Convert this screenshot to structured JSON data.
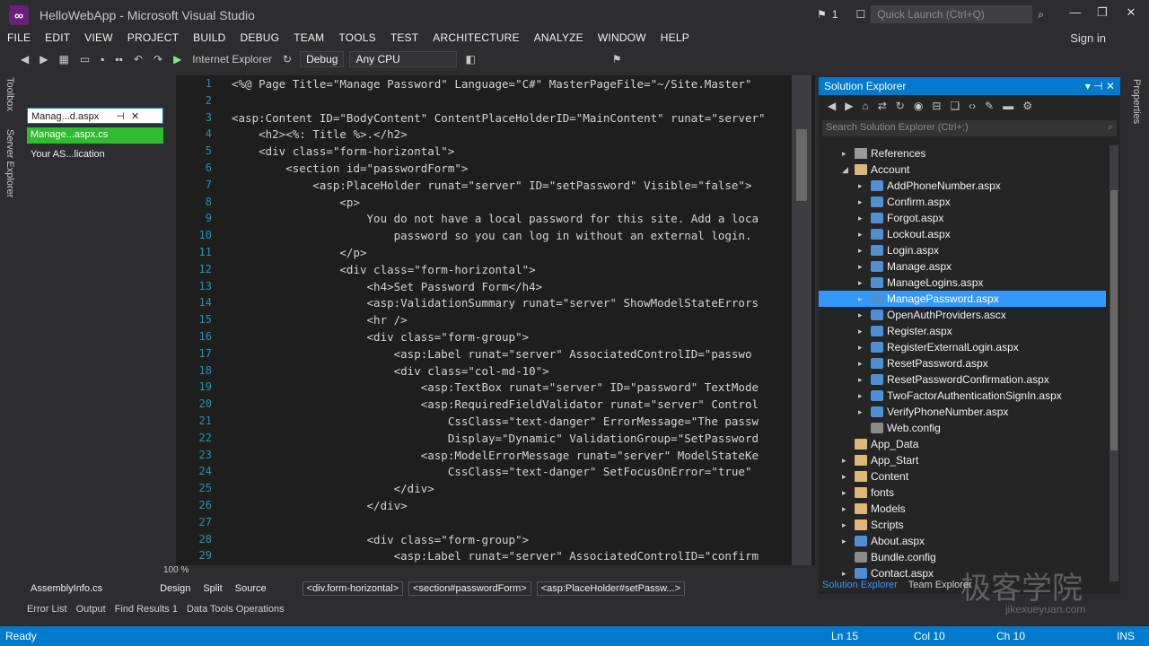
{
  "window": {
    "title": "HelloWebApp - Microsoft Visual Studio",
    "notifications": "1",
    "quick_launch": "Quick Launch (Ctrl+Q)",
    "sign_in": "Sign in"
  },
  "menu": [
    "FILE",
    "EDIT",
    "VIEW",
    "PROJECT",
    "BUILD",
    "DEBUG",
    "TEAM",
    "TOOLS",
    "TEST",
    "ARCHITECTURE",
    "ANALYZE",
    "WINDOW",
    "HELP"
  ],
  "toolbar": {
    "browser": "Internet Explorer",
    "config": "Debug",
    "platform": "Any CPU"
  },
  "left_rail": {
    "toolbox": "Toolbox",
    "server_explorer": "Server Explorer"
  },
  "doc_tabs": [
    "Manag...d.aspx",
    "Manage...aspx.cs",
    "Your AS...lication"
  ],
  "editor": {
    "zoom": "100 %",
    "lines": [
      {
        "n": "1",
        "text": "<%@ Page Title=\"Manage Password\" Language=\"C#\" MasterPageFile=\"~/Site.Master\""
      },
      {
        "n": "2",
        "text": ""
      },
      {
        "n": "3",
        "text": "<asp:Content ID=\"BodyContent\" ContentPlaceHolderID=\"MainContent\" runat=\"server\""
      },
      {
        "n": "4",
        "text": "    <h2><%: Title %>.</h2>"
      },
      {
        "n": "5",
        "text": "    <div class=\"form-horizontal\">"
      },
      {
        "n": "6",
        "text": "        <section id=\"passwordForm\">"
      },
      {
        "n": "7",
        "text": "            <asp:PlaceHolder runat=\"server\" ID=\"setPassword\" Visible=\"false\">"
      },
      {
        "n": "8",
        "text": "                <p>"
      },
      {
        "n": "9",
        "text": "                    You do not have a local password for this site. Add a loca"
      },
      {
        "n": "10",
        "text": "                        password so you can log in without an external login."
      },
      {
        "n": "11",
        "text": "                </p>"
      },
      {
        "n": "12",
        "text": "                <div class=\"form-horizontal\">"
      },
      {
        "n": "13",
        "text": "                    <h4>Set Password Form</h4>"
      },
      {
        "n": "14",
        "text": "                    <asp:ValidationSummary runat=\"server\" ShowModelStateErrors"
      },
      {
        "n": "15",
        "text": "                    <hr />"
      },
      {
        "n": "16",
        "text": "                    <div class=\"form-group\">"
      },
      {
        "n": "17",
        "text": "                        <asp:Label runat=\"server\" AssociatedControlID=\"passwo"
      },
      {
        "n": "18",
        "text": "                        <div class=\"col-md-10\">"
      },
      {
        "n": "19",
        "text": "                            <asp:TextBox runat=\"server\" ID=\"password\" TextMode"
      },
      {
        "n": "20",
        "text": "                            <asp:RequiredFieldValidator runat=\"server\" Control"
      },
      {
        "n": "21",
        "text": "                                CssClass=\"text-danger\" ErrorMessage=\"The passw"
      },
      {
        "n": "22",
        "text": "                                Display=\"Dynamic\" ValidationGroup=\"SetPassword"
      },
      {
        "n": "23",
        "text": "                            <asp:ModelErrorMessage runat=\"server\" ModelStateKe"
      },
      {
        "n": "24",
        "text": "                                CssClass=\"text-danger\" SetFocusOnError=\"true\""
      },
      {
        "n": "25",
        "text": "                        </div>"
      },
      {
        "n": "26",
        "text": "                    </div>"
      },
      {
        "n": "27",
        "text": ""
      },
      {
        "n": "28",
        "text": "                    <div class=\"form-group\">"
      },
      {
        "n": "29",
        "text": "                        <asp:Label runat=\"server\" AssociatedControlID=\"confirm"
      }
    ]
  },
  "design_bar": {
    "assembly_tab": "AssemblyInfo.cs",
    "design": "Design",
    "split": "Split",
    "source": "Source",
    "crumbs": [
      "<div.form-horizontal>",
      "<section#passwordForm>",
      "<asp:PlaceHolder#setPassw...>"
    ]
  },
  "output_tabs": [
    "Error List",
    "Output",
    "Find Results 1",
    "Data Tools Operations"
  ],
  "solution_explorer": {
    "title": "Solution Explorer",
    "search": "Search Solution Explorer (Ctrl+;)",
    "items": [
      {
        "label": "References",
        "type": "ref",
        "indent": 1,
        "arrow": "▸"
      },
      {
        "label": "Account",
        "type": "folder",
        "indent": 1,
        "arrow": "◢"
      },
      {
        "label": "AddPhoneNumber.aspx",
        "type": "page",
        "indent": 2,
        "arrow": "▸"
      },
      {
        "label": "Confirm.aspx",
        "type": "page",
        "indent": 2,
        "arrow": "▸"
      },
      {
        "label": "Forgot.aspx",
        "type": "page",
        "indent": 2,
        "arrow": "▸"
      },
      {
        "label": "Lockout.aspx",
        "type": "page",
        "indent": 2,
        "arrow": "▸"
      },
      {
        "label": "Login.aspx",
        "type": "page",
        "indent": 2,
        "arrow": "▸"
      },
      {
        "label": "Manage.aspx",
        "type": "page",
        "indent": 2,
        "arrow": "▸"
      },
      {
        "label": "ManageLogins.aspx",
        "type": "page",
        "indent": 2,
        "arrow": "▸"
      },
      {
        "label": "ManagePassword.aspx",
        "type": "page",
        "indent": 2,
        "arrow": "▸",
        "selected": true
      },
      {
        "label": "OpenAuthProviders.ascx",
        "type": "page",
        "indent": 2,
        "arrow": "▸"
      },
      {
        "label": "Register.aspx",
        "type": "page",
        "indent": 2,
        "arrow": "▸"
      },
      {
        "label": "RegisterExternalLogin.aspx",
        "type": "page",
        "indent": 2,
        "arrow": "▸"
      },
      {
        "label": "ResetPassword.aspx",
        "type": "page",
        "indent": 2,
        "arrow": "▸"
      },
      {
        "label": "ResetPasswordConfirmation.aspx",
        "type": "page",
        "indent": 2,
        "arrow": "▸"
      },
      {
        "label": "TwoFactorAuthenticationSignIn.aspx",
        "type": "page",
        "indent": 2,
        "arrow": "▸"
      },
      {
        "label": "VerifyPhoneNumber.aspx",
        "type": "page",
        "indent": 2,
        "arrow": "▸"
      },
      {
        "label": "Web.config",
        "type": "cfg",
        "indent": 2,
        "arrow": ""
      },
      {
        "label": "App_Data",
        "type": "folder",
        "indent": 1,
        "arrow": ""
      },
      {
        "label": "App_Start",
        "type": "folder",
        "indent": 1,
        "arrow": "▸"
      },
      {
        "label": "Content",
        "type": "folder",
        "indent": 1,
        "arrow": "▸"
      },
      {
        "label": "fonts",
        "type": "folder",
        "indent": 1,
        "arrow": "▸"
      },
      {
        "label": "Models",
        "type": "folder",
        "indent": 1,
        "arrow": "▸"
      },
      {
        "label": "Scripts",
        "type": "folder",
        "indent": 1,
        "arrow": "▸"
      },
      {
        "label": "About.aspx",
        "type": "page",
        "indent": 1,
        "arrow": "▸"
      },
      {
        "label": "Bundle.config",
        "type": "cfg",
        "indent": 1,
        "arrow": ""
      },
      {
        "label": "Contact.aspx",
        "type": "page",
        "indent": 1,
        "arrow": "▸"
      }
    ],
    "bottom_tabs": [
      "Solution Explorer",
      "Team Explorer"
    ]
  },
  "right_rail": {
    "properties": "Properties"
  },
  "watermark": {
    "cn": "极客学院",
    "url": "jikexueyuan.com"
  },
  "status": {
    "ready": "Ready",
    "ln": "Ln 15",
    "col": "Col 10",
    "ch": "Ch 10",
    "ins": "INS"
  },
  "colors": {
    "accent": "#007acc",
    "selection": "#3399ff",
    "editor_bg": "#1e1e1e"
  }
}
